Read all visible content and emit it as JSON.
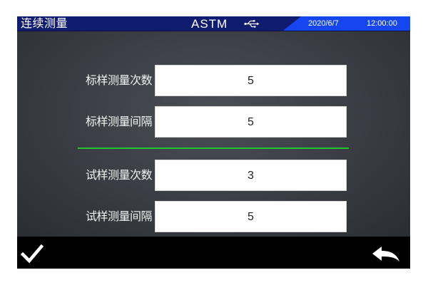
{
  "status_bar": {
    "title": "连续测量",
    "mode": "ASTM",
    "usb_icon": "usb-icon",
    "date": "2020/6/7",
    "time": "12:00:00",
    "colors": {
      "bar": "#101c70",
      "clock_panel": "#1646f0"
    }
  },
  "standard": {
    "count_label": "标样测量次数",
    "count_value": "5",
    "interval_label": "标样测量间隔",
    "interval_value": "5"
  },
  "sample": {
    "count_label": "试样测量次数",
    "count_value": "3",
    "interval_label": "试样测量间隔",
    "interval_value": "5"
  },
  "divider_color": "#22c52a",
  "bottom_bar": {
    "confirm_icon": "checkmark-icon",
    "back_icon": "back-arrow-icon"
  }
}
